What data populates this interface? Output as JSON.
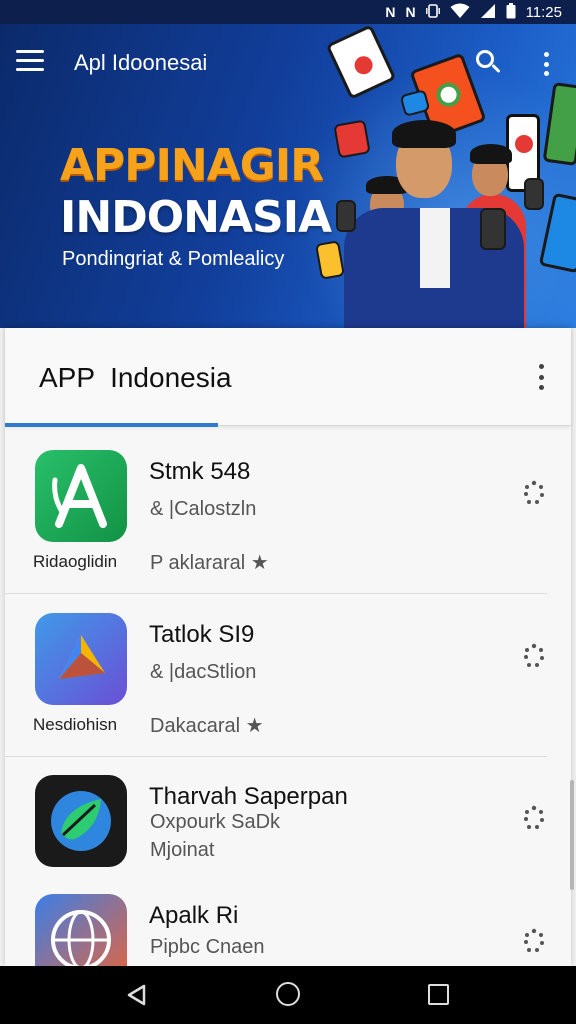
{
  "status_bar": {
    "time": "11:25",
    "icons": [
      "nfc-icon",
      "nfc-icon",
      "vibrate-icon",
      "wifi-icon",
      "signal-icon",
      "battery-icon"
    ]
  },
  "app_bar": {
    "title": "Apl Idoonesai",
    "icons": [
      "menu-icon",
      "search-icon",
      "more-vert-icon"
    ]
  },
  "promo": {
    "line1": "APPINAGIR",
    "line2": "INDONASIA",
    "line3": "Pondingriat & Pomlealicy"
  },
  "list_card": {
    "title": "APP  Indonesia",
    "active_tab_index": 0,
    "apps": [
      {
        "name": "Stmk 548",
        "subtitle": "& |Calostzln",
        "caption": "Ridaoglidin",
        "meta": "P aklararal",
        "rating_icon": "star-icon",
        "icon": "letter-a-app-icon",
        "icon_colors": [
          "#1fae52",
          "#17983f"
        ]
      },
      {
        "name": "Tatlok SI9",
        "subtitle": "& |dacStlion",
        "caption": "Nesdiohisn",
        "meta": "Dakacaral",
        "rating_icon": "star-icon",
        "icon": "play-triangle-app-icon",
        "icon_colors": [
          "#3f8fe8",
          "#6a52d8"
        ]
      },
      {
        "name": "Tharvah Saperpan",
        "subtitle": "Oxpourk SaDk",
        "caption": "",
        "meta": "Mjoinat",
        "rating_icon": "",
        "icon": "globe-leaf-app-icon",
        "icon_colors": [
          "#1a1a1a",
          "#2b2b2b"
        ]
      },
      {
        "name": "Apalk Ri",
        "subtitle": "Pipbc Cnaen",
        "caption": "",
        "meta": "",
        "rating_icon": "",
        "icon": "globe-app-icon",
        "icon_colors": [
          "#2f7be8",
          "#e8643a"
        ]
      }
    ]
  },
  "nav_bar": {
    "icons": [
      "back-icon",
      "home-icon",
      "recents-icon"
    ]
  }
}
